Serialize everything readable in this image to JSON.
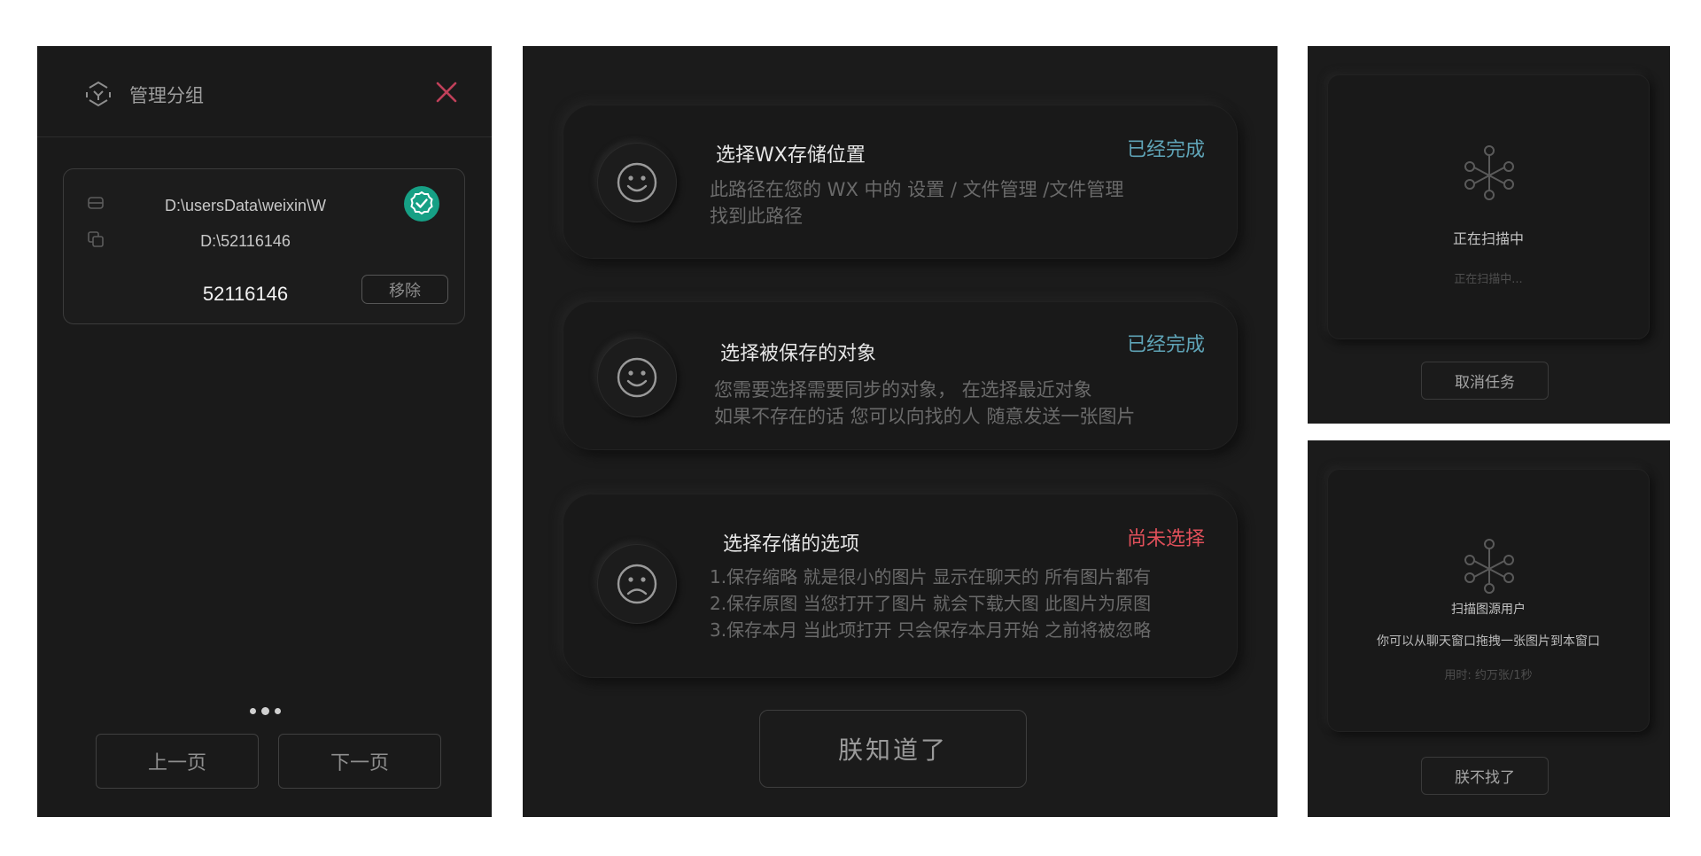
{
  "group_panel": {
    "title": "管理分组",
    "card": {
      "path_data": "D:\\usersData\\weixin\\W",
      "path_save": "D:\\52116146",
      "group_id": "52116146",
      "remove_label": "移除"
    },
    "prev_label": "上一页",
    "next_label": "下一页"
  },
  "steps_panel": {
    "steps": [
      {
        "title": "选择WX存储位置",
        "status": "已经完成",
        "status_color": "#5fa4b7",
        "face": "smile",
        "desc": [
          "此路径在您的 WX 中的  设置  / 文件管理  /文件管理",
          "找到此路径"
        ]
      },
      {
        "title": "选择被保存的对象",
        "status": "已经完成",
        "status_color": "#5fa4b7",
        "face": "smile",
        "desc": [
          "您需要选择需要同步的对象， 在选择最近对象",
          "如果不存在的话 您可以向找的人 随意发送一张图片"
        ]
      },
      {
        "title": "选择存储的选项",
        "status": "尚未选择",
        "status_color": "#e0505a",
        "face": "frown",
        "desc": [
          "1.保存缩略  就是很小的图片 显示在聊天的 所有图片都有",
          "2.保存原图  当您打开了图片 就会下载大图 此图片为原图",
          "3.保存本月  当此项打开 只会保存本月开始 之前将被忽略"
        ]
      }
    ],
    "confirm_label": "朕知道了"
  },
  "scan_panel": {
    "title": "正在扫描中",
    "subtitle": "正在扫描中...",
    "cancel_label": "取消任务"
  },
  "user_scan_panel": {
    "title": "扫描图源用户",
    "hint": "你可以从聊天窗口拖拽一张图片到本窗口",
    "timing": "用时:  约万张/1秒",
    "cancel_label": "朕不找了"
  },
  "colors": {
    "verified": "#16a085",
    "close": "#c0405a",
    "done": "#5fa4b7",
    "pending": "#e0505a"
  },
  "icons": {
    "logo": "group-logo-icon",
    "close": "close-icon",
    "drive": "drive-icon",
    "copy": "copy-icon",
    "verified": "verified-badge-icon",
    "network": "network-nodes-icon"
  }
}
